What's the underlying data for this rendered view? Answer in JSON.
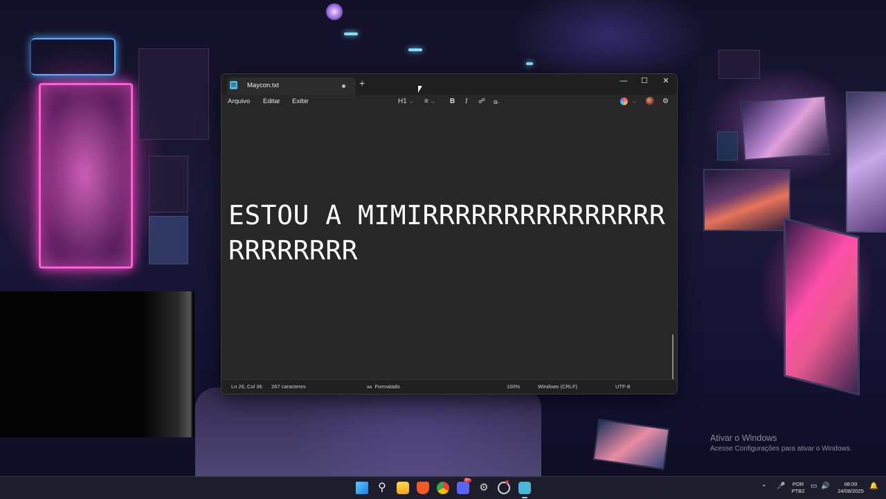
{
  "colors": {
    "window_bg": "#272727",
    "titlebar_bg": "#1f1f1f",
    "text": "#ffffff",
    "accent": "#49b7d9"
  },
  "window": {
    "tab_title": "Maycon.txt",
    "new_tab_symbol": "+",
    "controls": {
      "minimize": "—",
      "maximize": "☐",
      "close": "✕"
    }
  },
  "menu": {
    "file": "Arquivo",
    "edit": "Editar",
    "view": "Exibir"
  },
  "toolbar": {
    "heading_level": "H1",
    "list_icon": "list-icon",
    "bold": "B",
    "italic": "I",
    "link_icon": "link-icon",
    "clear_format_icon": "clear-format-icon",
    "copilot_icon": "copilot-icon",
    "account_icon": "avatar",
    "settings_icon": "gear-icon"
  },
  "document": {
    "text": "ESTOU A MIMIRRRRRRRRRRRRRRRRRRRRRRR"
  },
  "status": {
    "position": "Ln 26, Col 36",
    "chars": "267 caracteres",
    "format": "Formatado",
    "zoom": "100%",
    "line_ending": "Windows (CRLF)",
    "encoding": "UTF-8"
  },
  "watermark": {
    "title": "Ativar o Windows",
    "subtitle": "Acesse Configurações para ativar o Windows."
  },
  "taskbar": {
    "apps": [
      "windows-start-icon",
      "search-icon",
      "file-explorer-icon",
      "brave-icon",
      "chrome-icon",
      "discord-icon",
      "steam-icon",
      "app-icon",
      "notepad-icon"
    ],
    "discord_badge": "9+",
    "language": "POR",
    "keyboard": "PTB2",
    "time": "08:00",
    "date": "24/08/2025"
  }
}
